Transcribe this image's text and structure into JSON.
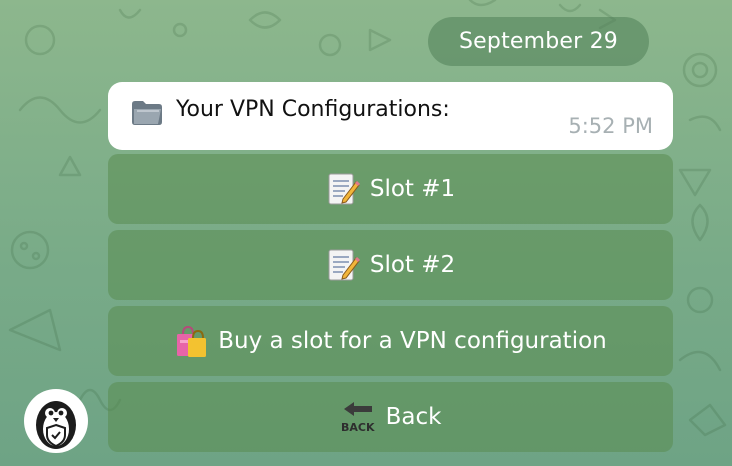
{
  "date_separator": "September 29",
  "message": {
    "icon": "folder-icon",
    "text": "Your VPN Configurations:",
    "time": "5:52 PM"
  },
  "keyboard": [
    {
      "icon": "memo-icon",
      "label": "Slot #1"
    },
    {
      "icon": "memo-icon",
      "label": "Slot #2"
    },
    {
      "icon": "shopping-bags-icon",
      "label": "Buy a slot for a VPN configuration"
    },
    {
      "icon": "back-arrow-icon",
      "icon_text": "BACK",
      "label": "Back"
    }
  ],
  "bot_avatar": {
    "icon": "penguin-shield-icon"
  },
  "colors": {
    "chat_background": "#82b08a",
    "bubble": "#ffffff",
    "button_bg": "#6a9a62",
    "time_text": "#a7b0b3"
  }
}
